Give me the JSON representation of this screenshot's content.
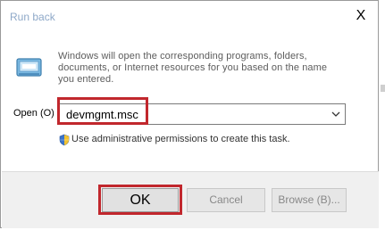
{
  "window": {
    "title": "Run back",
    "close_glyph": "X"
  },
  "description": "Windows will open the corresponding programs, folders, documents, or Internet resources for you based on the name you entered.",
  "open_label": "Open (O)",
  "input": {
    "value": "devmgmt.msc"
  },
  "admin_note": "Use administrative permissions to create this task.",
  "buttons": {
    "ok": "OK",
    "cancel": "Cancel",
    "browse": "Browse (B)..."
  },
  "icons": {
    "run": "run-icon",
    "shield": "shield-icon",
    "dropdown": "chevron-down-icon"
  },
  "colors": {
    "highlight": "#c1272d",
    "title": "#8ea8c8",
    "footer": "#f0f0f0"
  }
}
